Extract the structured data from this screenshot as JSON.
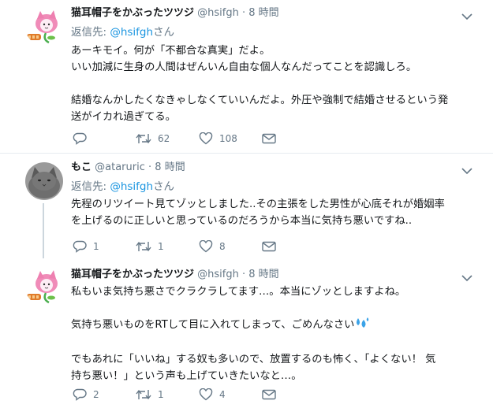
{
  "colors": {
    "link": "#1b95e0",
    "muted": "#657786",
    "text": "#14171a",
    "divider": "#e6ecf0"
  },
  "tweets": [
    {
      "name": "猫耳帽子をかぶったツツジ",
      "handle": "@hsifgh",
      "dot": "·",
      "time": "8 時間",
      "reply_prefix": "返信先: ",
      "reply_handle": "@hsifgh",
      "reply_suffix": "さん",
      "text": "あーキモイ。何が「不都合な真実」だよ。\nいい加減に生身の人間はぜんいん自由な個人なんだってことを認識しろ。\n\n結婚なんかしたくなきゃしなくていいんだよ。外圧や強制で結婚させるという発\n送がイカれ過ぎてる。",
      "replies": "",
      "retweets": "62",
      "likes": "108"
    },
    {
      "name": "もこ",
      "handle": "@ataruric",
      "dot": "·",
      "time": "8 時間",
      "reply_prefix": "返信先: ",
      "reply_handle": "@hsifgh",
      "reply_suffix": "さん",
      "text": "先程のリツイート見てゾッとしました..その主張をした男性が心底それが婚姻率\nを上げるのに正しいと思っているのだろうから本当に気持ち悪いですね..",
      "replies": "1",
      "retweets": "1",
      "likes": "8"
    },
    {
      "name": "猫耳帽子をかぶったツツジ",
      "handle": "@hsifgh",
      "dot": "·",
      "time": "8 時間",
      "text_1": "私もいま気持ち悪さでクラクラしてます…。本当にゾッとしますよね。\n\n気持ち悪いものをRTして目に入れてしまって、ごめんなさい",
      "text_2": "\n\nでもあれに「いいね」する奴も多いので、放置するのも怖く、「よくない！ 気\n持ち悪い！」という声も上げていきたいなと…。",
      "replies": "2",
      "retweets": "1",
      "likes": "4"
    }
  ]
}
